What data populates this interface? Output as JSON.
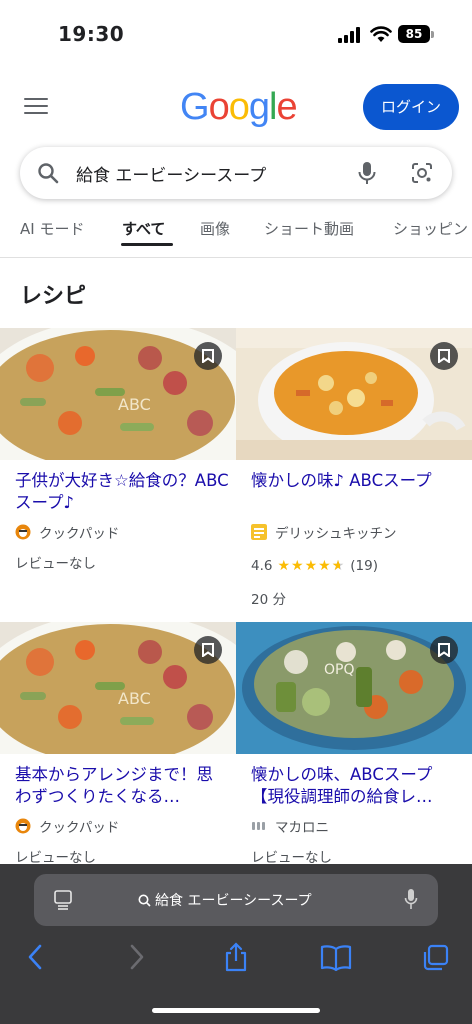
{
  "status_bar": {
    "time": "19:30",
    "battery": "85"
  },
  "header": {
    "logo_letters": [
      {
        "char": "G",
        "color": "#4285F4"
      },
      {
        "char": "o",
        "color": "#EA4335"
      },
      {
        "char": "o",
        "color": "#FBBC05"
      },
      {
        "char": "g",
        "color": "#4285F4"
      },
      {
        "char": "l",
        "color": "#34A853"
      },
      {
        "char": "e",
        "color": "#EA4335"
      }
    ],
    "login_label": "ログイン"
  },
  "search": {
    "query": "給食 エービーシースープ"
  },
  "tabs": [
    {
      "label": "AI モード",
      "active": false
    },
    {
      "label": "すべて",
      "active": true
    },
    {
      "label": "画像",
      "active": false
    },
    {
      "label": "ショート動画",
      "active": false
    },
    {
      "label": "ショッピン",
      "active": false
    }
  ],
  "section": {
    "title": "レシピ"
  },
  "recipes": [
    {
      "title": "子供が大好き☆給食の？ABCスープ♪",
      "source": "クックパッド",
      "source_icon": "cookpad-icon",
      "review": "レビューなし"
    },
    {
      "title": "懐かしの味♪ ABCスープ",
      "source": "デリッシュキッチン",
      "source_icon": "delish-kitchen-icon",
      "rating_value": "4.6",
      "rating_stars": 4.6,
      "rating_count": "(19)",
      "time": "20 分"
    },
    {
      "title": "基本からアレンジまで！思わずつくりたくなる…",
      "source": "クックパッド",
      "source_icon": "cookpad-icon",
      "review": "レビューなし"
    },
    {
      "title": "懐かしの味、ABCスープ【現役調理師の給食レ…",
      "source": "マカロニ",
      "source_icon": "macaroni-icon",
      "review": "レビューなし"
    }
  ],
  "browser_bar": {
    "url_text": "給食 エービーシースープ"
  },
  "colors": {
    "link": "#1a0dab",
    "login_bg": "#0b57d0",
    "star": "#fbbc04",
    "safari_bg": "#3a3a3c",
    "safari_icon": "#3b82f6"
  }
}
